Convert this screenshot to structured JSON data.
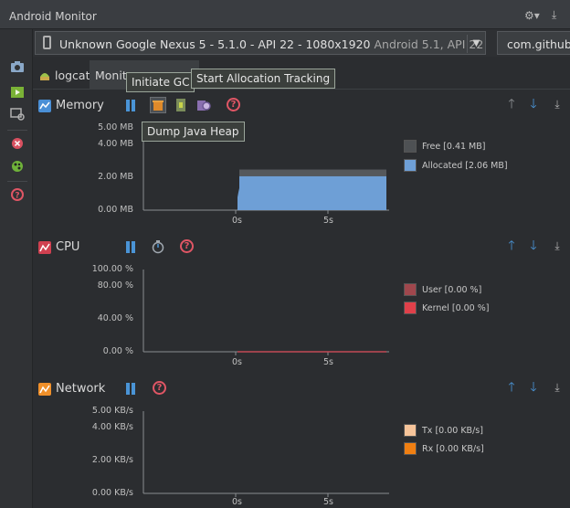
{
  "window": {
    "title": "Android Monitor"
  },
  "devices": {
    "name": "Unknown Google Nexus 5 - 5.1.0 - API 22 - 1080x1920",
    "info": "Android 5.1, API 22",
    "app": "com.github"
  },
  "tabs": {
    "logcat": "logcat",
    "monitors": "Monitors"
  },
  "tooltips": {
    "initiate_gc": "Initiate GC",
    "start_alloc": "Start Allocation Tracking",
    "dump_heap": "Dump Java Heap"
  },
  "memory": {
    "title": "Memory",
    "color": "#4a8fd6",
    "yticks": [
      "5.00 MB",
      "4.00 MB",
      "2.00 MB",
      "0.00 MB"
    ],
    "xticks": [
      "0s",
      "5s"
    ],
    "legend": [
      {
        "label": "Free [0.41 MB]",
        "color": "#4e5154"
      },
      {
        "label": "Allocated [2.06 MB]",
        "color": "#6e9fd6"
      }
    ],
    "chart_data": {
      "type": "area",
      "ylim": [
        0,
        5
      ],
      "series": [
        {
          "name": "Free [0.41 MB]",
          "values": [
            0.41
          ]
        },
        {
          "name": "Allocated [2.06 MB]",
          "values": [
            2.06
          ]
        }
      ]
    }
  },
  "cpu": {
    "title": "CPU",
    "color": "#d04050",
    "yticks": [
      "100.00 %",
      "80.00 %",
      "40.00 %",
      "0.00 %"
    ],
    "xticks": [
      "0s",
      "5s"
    ],
    "legend": [
      {
        "label": "User [0.00 %]",
        "color": "#a0474d"
      },
      {
        "label": "Kernel [0.00 %]",
        "color": "#e0404a"
      }
    ]
  },
  "network": {
    "title": "Network",
    "color": "#f0902a",
    "yticks": [
      "5.00 KB/s",
      "4.00 KB/s",
      "2.00 KB/s",
      "0.00 KB/s"
    ],
    "xticks": [
      "0s",
      "5s"
    ],
    "legend": [
      {
        "label": "Tx [0.00 KB/s]",
        "color": "#f6c49a"
      },
      {
        "label": "Rx [0.00 KB/s]",
        "color": "#f07f12"
      }
    ]
  }
}
